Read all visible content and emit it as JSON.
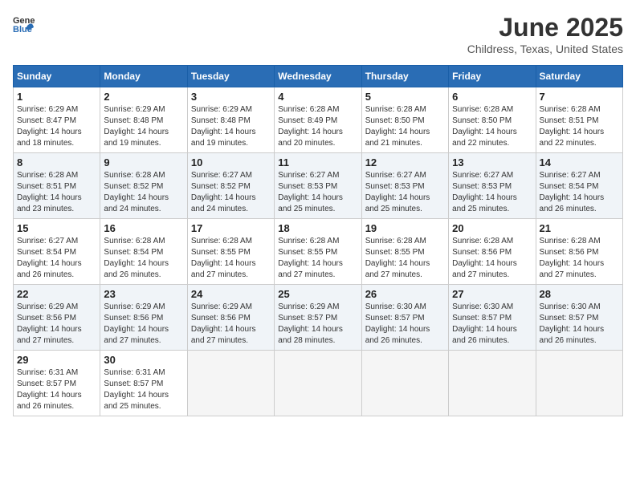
{
  "header": {
    "logo_general": "General",
    "logo_blue": "Blue",
    "month_title": "June 2025",
    "location": "Childress, Texas, United States"
  },
  "days_of_week": [
    "Sunday",
    "Monday",
    "Tuesday",
    "Wednesday",
    "Thursday",
    "Friday",
    "Saturday"
  ],
  "weeks": [
    [
      {
        "day": "1",
        "sunrise": "6:29 AM",
        "sunset": "8:47 PM",
        "daylight": "14 hours and 18 minutes."
      },
      {
        "day": "2",
        "sunrise": "6:29 AM",
        "sunset": "8:48 PM",
        "daylight": "14 hours and 19 minutes."
      },
      {
        "day": "3",
        "sunrise": "6:29 AM",
        "sunset": "8:48 PM",
        "daylight": "14 hours and 19 minutes."
      },
      {
        "day": "4",
        "sunrise": "6:28 AM",
        "sunset": "8:49 PM",
        "daylight": "14 hours and 20 minutes."
      },
      {
        "day": "5",
        "sunrise": "6:28 AM",
        "sunset": "8:50 PM",
        "daylight": "14 hours and 21 minutes."
      },
      {
        "day": "6",
        "sunrise": "6:28 AM",
        "sunset": "8:50 PM",
        "daylight": "14 hours and 22 minutes."
      },
      {
        "day": "7",
        "sunrise": "6:28 AM",
        "sunset": "8:51 PM",
        "daylight": "14 hours and 22 minutes."
      }
    ],
    [
      {
        "day": "8",
        "sunrise": "6:28 AM",
        "sunset": "8:51 PM",
        "daylight": "14 hours and 23 minutes."
      },
      {
        "day": "9",
        "sunrise": "6:28 AM",
        "sunset": "8:52 PM",
        "daylight": "14 hours and 24 minutes."
      },
      {
        "day": "10",
        "sunrise": "6:27 AM",
        "sunset": "8:52 PM",
        "daylight": "14 hours and 24 minutes."
      },
      {
        "day": "11",
        "sunrise": "6:27 AM",
        "sunset": "8:53 PM",
        "daylight": "14 hours and 25 minutes."
      },
      {
        "day": "12",
        "sunrise": "6:27 AM",
        "sunset": "8:53 PM",
        "daylight": "14 hours and 25 minutes."
      },
      {
        "day": "13",
        "sunrise": "6:27 AM",
        "sunset": "8:53 PM",
        "daylight": "14 hours and 25 minutes."
      },
      {
        "day": "14",
        "sunrise": "6:27 AM",
        "sunset": "8:54 PM",
        "daylight": "14 hours and 26 minutes."
      }
    ],
    [
      {
        "day": "15",
        "sunrise": "6:27 AM",
        "sunset": "8:54 PM",
        "daylight": "14 hours and 26 minutes."
      },
      {
        "day": "16",
        "sunrise": "6:28 AM",
        "sunset": "8:54 PM",
        "daylight": "14 hours and 26 minutes."
      },
      {
        "day": "17",
        "sunrise": "6:28 AM",
        "sunset": "8:55 PM",
        "daylight": "14 hours and 27 minutes."
      },
      {
        "day": "18",
        "sunrise": "6:28 AM",
        "sunset": "8:55 PM",
        "daylight": "14 hours and 27 minutes."
      },
      {
        "day": "19",
        "sunrise": "6:28 AM",
        "sunset": "8:55 PM",
        "daylight": "14 hours and 27 minutes."
      },
      {
        "day": "20",
        "sunrise": "6:28 AM",
        "sunset": "8:56 PM",
        "daylight": "14 hours and 27 minutes."
      },
      {
        "day": "21",
        "sunrise": "6:28 AM",
        "sunset": "8:56 PM",
        "daylight": "14 hours and 27 minutes."
      }
    ],
    [
      {
        "day": "22",
        "sunrise": "6:29 AM",
        "sunset": "8:56 PM",
        "daylight": "14 hours and 27 minutes."
      },
      {
        "day": "23",
        "sunrise": "6:29 AM",
        "sunset": "8:56 PM",
        "daylight": "14 hours and 27 minutes."
      },
      {
        "day": "24",
        "sunrise": "6:29 AM",
        "sunset": "8:56 PM",
        "daylight": "14 hours and 27 minutes."
      },
      {
        "day": "25",
        "sunrise": "6:29 AM",
        "sunset": "8:57 PM",
        "daylight": "14 hours and 28 minutes."
      },
      {
        "day": "26",
        "sunrise": "6:30 AM",
        "sunset": "8:57 PM",
        "daylight": "14 hours and 26 minutes."
      },
      {
        "day": "27",
        "sunrise": "6:30 AM",
        "sunset": "8:57 PM",
        "daylight": "14 hours and 26 minutes."
      },
      {
        "day": "28",
        "sunrise": "6:30 AM",
        "sunset": "8:57 PM",
        "daylight": "14 hours and 26 minutes."
      }
    ],
    [
      {
        "day": "29",
        "sunrise": "6:31 AM",
        "sunset": "8:57 PM",
        "daylight": "14 hours and 26 minutes."
      },
      {
        "day": "30",
        "sunrise": "6:31 AM",
        "sunset": "8:57 PM",
        "daylight": "14 hours and 25 minutes."
      },
      null,
      null,
      null,
      null,
      null
    ]
  ]
}
